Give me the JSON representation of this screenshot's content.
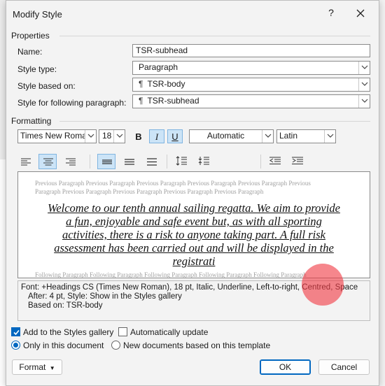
{
  "dialog": {
    "title": "Modify Style",
    "help_label": "?"
  },
  "properties": {
    "section_label": "Properties",
    "name_label": "Name:",
    "name_value": "TSR-subhead",
    "style_type_label": "Style type:",
    "style_type_value": "Paragraph",
    "based_on_label": "Style based on:",
    "based_on_value": "TSR-body",
    "following_label": "Style for following paragraph:",
    "following_value": "TSR-subhead"
  },
  "formatting": {
    "section_label": "Formatting",
    "font": "Times New Roman",
    "size": "18",
    "bold": "B",
    "italic": "I",
    "underline": "U",
    "color": "Automatic",
    "script": "Latin"
  },
  "preview": {
    "previous_line1": "Previous Paragraph Previous Paragraph Previous Paragraph Previous Paragraph Previous Paragraph Previous",
    "previous_line2": "Paragraph Previous Paragraph Previous Paragraph Previous Paragraph Previous Paragraph",
    "main_text": "Welcome to our tenth annual sailing regatta. We aim to provide a fun, enjoyable and safe event but, as with all sporting activities, there is a risk to anyone taking part. A full risk assessment has been carried out and will be displayed in the registrati",
    "following_line": "Following Paragraph Following Paragraph Following Paragraph Following Paragraph Following Paragraph"
  },
  "description": {
    "line1": "Font: +Headings CS (Times New Roman), 18 pt, Italic, Underline, Left-to-right, Centred, Space",
    "line2": "After:  4 pt, Style: Show in the Styles gallery",
    "line3": "Based on: TSR-body"
  },
  "options": {
    "add_to_gallery": "Add to the Styles gallery",
    "add_to_gallery_checked": true,
    "auto_update": "Automatically update",
    "auto_update_checked": false,
    "only_this_document": "Only in this document",
    "new_documents": "New documents based on this template"
  },
  "buttons": {
    "format": "Format",
    "ok": "OK",
    "cancel": "Cancel"
  },
  "colors": {
    "accent": "#0067c0",
    "toggle_active_bg": "#cce4f7",
    "cursor_highlight": "#f03c46"
  }
}
